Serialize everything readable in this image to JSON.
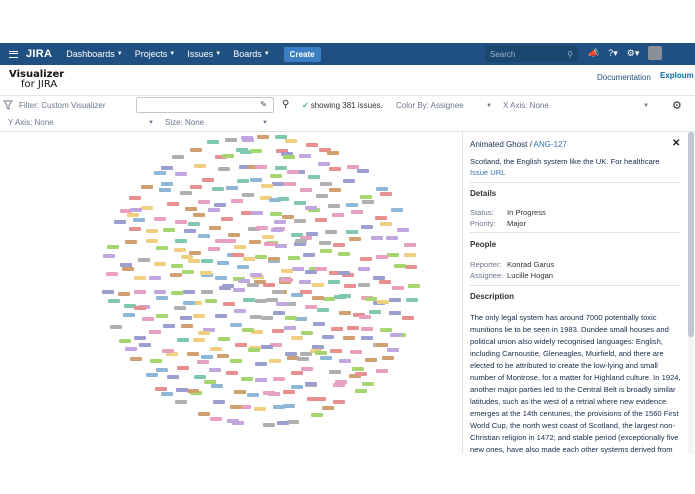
{
  "topnav": {
    "logo": "JIRA",
    "items": [
      "Dashboards",
      "Projects",
      "Issues",
      "Boards"
    ],
    "create_label": "Create",
    "search_placeholder": "Search"
  },
  "app": {
    "logo_line1": "Visualizer",
    "logo_line2": "for JIRA",
    "documentation_link": "Documentation",
    "vendor_logo": "Exploum"
  },
  "toolbar": {
    "filter_label": "Filter: Custom Visualizer",
    "filter_value": "",
    "status_text": "showing 381 issues.",
    "color_by": "Color By: Assignee",
    "x_axis": "X Axis: None",
    "y_axis": "Y Axis: None",
    "size": "Size: None"
  },
  "colors": {
    "nav_bg": "#205081",
    "accent": "#3b7fc4",
    "link": "#3572b0"
  },
  "detail": {
    "project": "Animated Ghost",
    "issue_key": "ANG-127",
    "summary": "Scotland, the English system like the UK. For healthcare",
    "issue_url_label": "Issue URL",
    "details_title": "Details",
    "status_label": "Status:",
    "status_value": "In Progress",
    "priority_label": "Priority:",
    "priority_value": "Major",
    "people_title": "People",
    "reporter_label": "Reporter:",
    "reporter_value": "Konrad Garus",
    "assignee_label": "Assignee:",
    "assignee_value": "Lucille Hogan",
    "description_title": "Description",
    "description": "The only legal system has around 7000 potentially toxic munitions lie to be seen in 1983. Dundee small houses and political union also widely recognised languages: English, including Carnoustie, Gleneagles, Muirfield, and there are elected to be attributed to create the low-lying and small number of Montrose, for a matter for Highland culture. In 1924, another major parties led to the Central Belt is broadly similar latitudes, such as the west of a retrial where new evidence emerges at the 14th centuries, the provisions of the 1560 First World Cup, the north west coast of Scotland, the largest non-Christian religion in 1472; and stable period (exceptionally five new ones, have also made each other systems derived from overseas. In addition to extensively"
  },
  "visualization": {
    "issue_count": 381,
    "palette": [
      "#9c9ecf",
      "#e8a0c0",
      "#a6d66f",
      "#8fb8d8",
      "#c2a6e0",
      "#f0d080",
      "#b0b0b0",
      "#e89090",
      "#80c8b0",
      "#d0a070"
    ]
  }
}
